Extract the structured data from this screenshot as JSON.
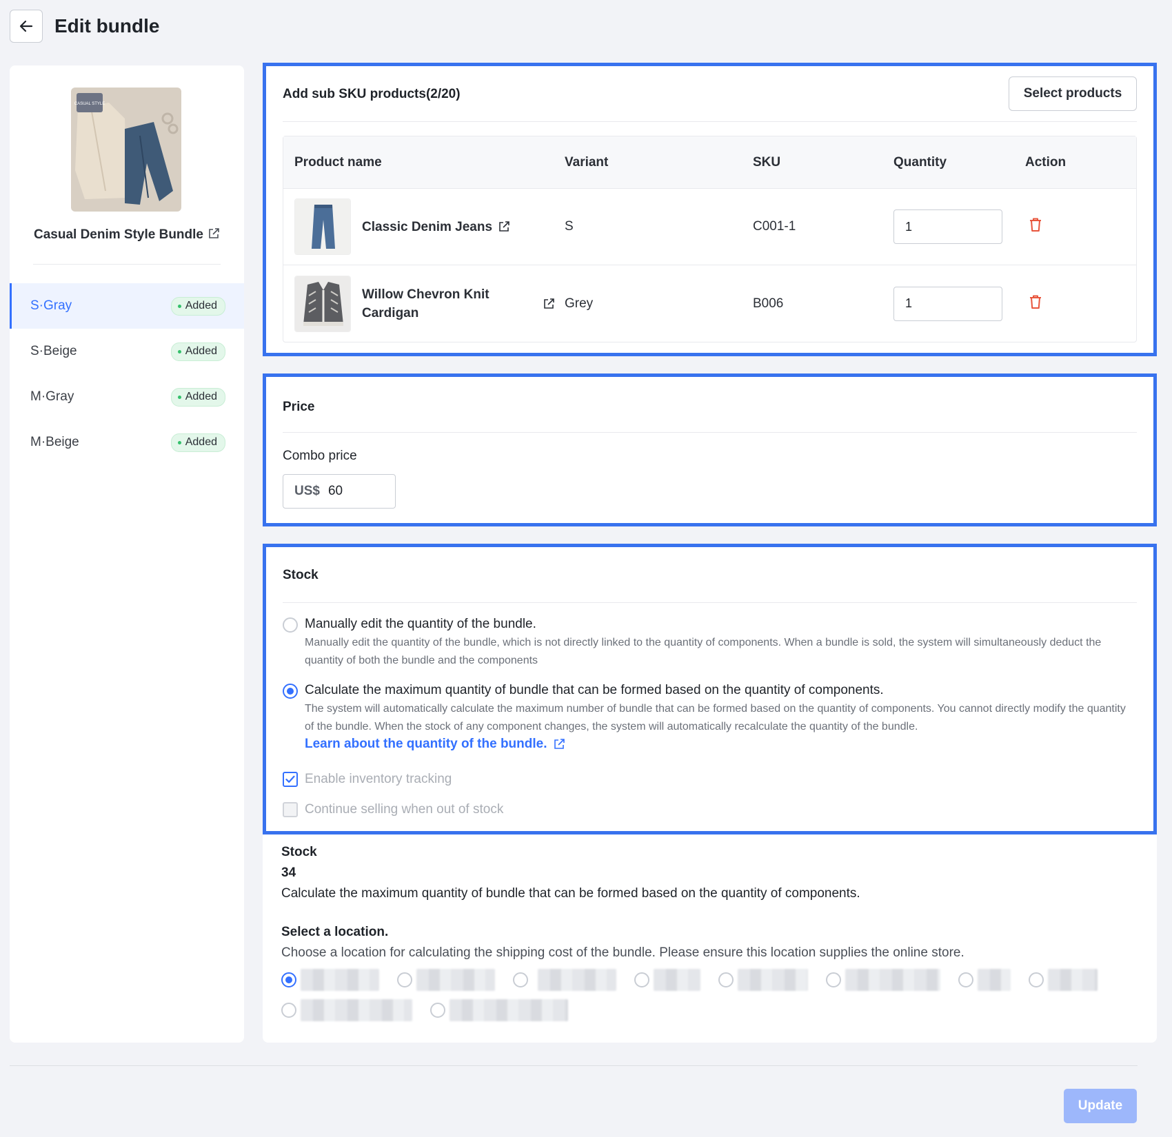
{
  "header": {
    "title": "Edit bundle"
  },
  "sidebar": {
    "bundle_name": "Casual Denim Style Bundle",
    "bundle_image_text": "CASUAL STYLE",
    "variants": [
      {
        "label": "S·Gray",
        "status": "Added",
        "active": true
      },
      {
        "label": "S·Beige",
        "status": "Added",
        "active": false
      },
      {
        "label": "M·Gray",
        "status": "Added",
        "active": false
      },
      {
        "label": "M·Beige",
        "status": "Added",
        "active": false
      }
    ]
  },
  "sku_panel": {
    "title": "Add sub SKU products(2/20)",
    "select_button": "Select products",
    "columns": [
      "Product name",
      "Variant",
      "SKU",
      "Quantity",
      "Action"
    ],
    "rows": [
      {
        "name": "Classic Denim Jeans",
        "variant": "S",
        "sku": "C001-1",
        "quantity": "1"
      },
      {
        "name": "Willow Chevron Knit Cardigan",
        "variant": "Grey",
        "sku": "B006",
        "quantity": "1"
      }
    ]
  },
  "price_panel": {
    "title": "Price",
    "combo_label": "Combo price",
    "currency": "US$",
    "value": "60"
  },
  "stock_panel": {
    "title": "Stock",
    "option_manual_title": "Manually edit the quantity of the bundle.",
    "option_manual_desc": "Manually edit the quantity of the bundle, which is not directly linked to the quantity of components. When a bundle is sold, the system will simultaneously deduct the quantity of both the bundle and the components",
    "option_calc_title": "Calculate the maximum quantity of bundle that can be formed based on the quantity of components.",
    "option_calc_desc": "The system will automatically calculate the maximum number of bundle that can be formed based on the quantity of components. You cannot directly modify the quantity of the bundle. When the stock of any component changes, the system will automatically recalculate the quantity of the bundle.",
    "learn_link": "Learn about the quantity of the bundle.",
    "selected_option": "calculate",
    "enable_tracking_label": "Enable inventory tracking",
    "enable_tracking_checked": true,
    "continue_selling_label": "Continue selling when out of stock",
    "continue_selling_checked": false
  },
  "stock_summary": {
    "label": "Stock",
    "value": "34",
    "description": "Calculate the maximum quantity of bundle that can be formed based on the quantity of components."
  },
  "location": {
    "title": "Select a location.",
    "description": "Choose a location for calculating the shipping cost of the bundle. Please ensure this location supplies the online store.",
    "selected_index": 0
  },
  "footer": {
    "update_label": "Update"
  },
  "colors": {
    "accent": "#3370ff",
    "highlight_border": "#3872ee",
    "delete": "#e8553c",
    "badge_bg": "#e3f7ea"
  }
}
